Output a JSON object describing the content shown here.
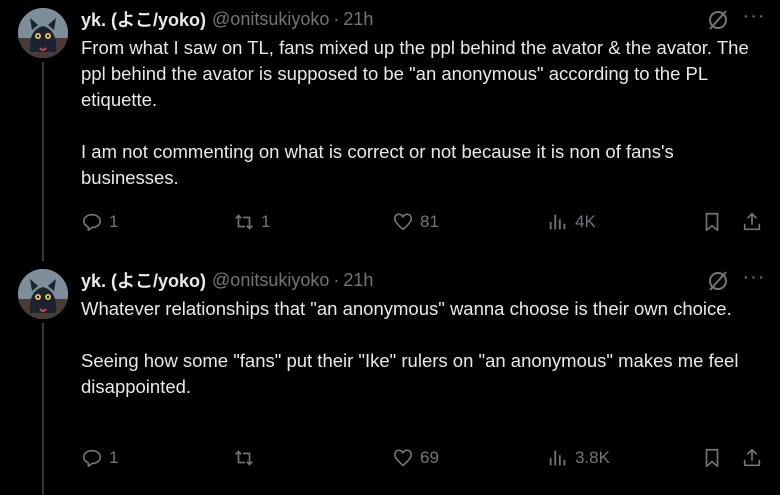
{
  "tweets": [
    {
      "author_name": "yk. (よこ/yoko)",
      "handle": "@onitsukiyoko",
      "separator": "·",
      "time": "21h",
      "text": "From what I saw on TL, fans mixed up the ppl behind the avator & the avator. The ppl behind the avator is supposed to be \"an anonymous\" according to the PL etiquette.\n\nI am not commenting on what is correct or not because it is non of fans's businesses.",
      "replies": "1",
      "reposts": "1",
      "likes": "81",
      "views": "4K",
      "more_label": "···"
    },
    {
      "author_name": "yk. (よこ/yoko)",
      "handle": "@onitsukiyoko",
      "separator": "·",
      "time": "21h",
      "text": "Whatever relationships that \"an anonymous\" wanna choose is their own choice.\n\nSeeing how some \"fans\" put their \"Ike\" rulers on \"an anonymous\" makes me feel disappointed.",
      "replies": "1",
      "reposts": "",
      "likes": "69",
      "views": "3.8K",
      "more_label": "···"
    }
  ],
  "colors": {
    "background": "#000000",
    "text": "#e7e9ea",
    "muted": "#71767b",
    "thread_line": "#333639"
  },
  "icons": [
    "grok-icon",
    "more-icon",
    "reply-icon",
    "repost-icon",
    "like-icon",
    "views-icon",
    "bookmark-icon",
    "share-icon"
  ]
}
